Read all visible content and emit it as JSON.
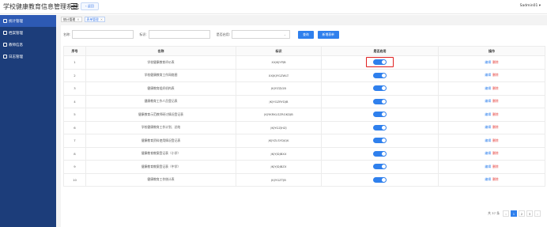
{
  "app": {
    "title": "学校健康教育信息管理系统",
    "back_label": "返回",
    "user": "Sadmin01 ▾"
  },
  "sidebar": {
    "items": [
      {
        "label": "统计管理"
      },
      {
        "label": "档案管理"
      },
      {
        "label": "教师信息"
      },
      {
        "label": "日志管理"
      }
    ]
  },
  "tabs": [
    {
      "label": "统计管理"
    },
    {
      "label": "表单管理"
    }
  ],
  "search": {
    "name_label": "名称:",
    "code_label": "标识:",
    "enable_label": "是否启用:",
    "query_button": "查询",
    "add_button": "新增表单"
  },
  "table": {
    "headers": [
      "序号",
      "名称",
      "标识",
      "是否启用",
      "操作"
    ],
    "rows": [
      {
        "no": "1",
        "name": "学校健康教育评价表",
        "code": "XXJKJYPJB"
      },
      {
        "no": "2",
        "name": "学校健康教育工作网络图",
        "code": "XXJKJYGZWLT"
      },
      {
        "no": "3",
        "name": "健康教育组织机构表",
        "code": "JKJYZZJGB"
      },
      {
        "no": "4",
        "name": "健康教育工作人员登记表",
        "code": "JKJYGZRYDJB"
      },
      {
        "no": "5",
        "name": "健康教育示范教师研讨情况登记表",
        "code": "JKJYKRKLSZRGKDJB"
      },
      {
        "no": "6",
        "name": "学校健康教育工作计划、总结",
        "code": "JKJYGZJHZJ"
      },
      {
        "no": "7",
        "name": "健康教育资料使用情况登记表",
        "code": "JKJYZLSYDJQK"
      },
      {
        "no": "8",
        "name": "健康教育教案登记表（小学）",
        "code": "JKJYJDJBXX"
      },
      {
        "no": "9",
        "name": "健康教育教案登记表（中学）",
        "code": "JKJYJDJBZX"
      },
      {
        "no": "10",
        "name": "健康教育工作统计表",
        "code": "JKJYGZTJB"
      }
    ],
    "edit_label": "编辑",
    "delete_label": "删除"
  },
  "pager": {
    "total": "共 37 条",
    "prev": "‹",
    "pages": [
      "1",
      "2",
      "3"
    ],
    "next": "›"
  },
  "colors": {
    "sidebar": "#1c3d7a",
    "accent": "#2f80ed",
    "danger": "#e53935",
    "highlight": "#e02020"
  }
}
